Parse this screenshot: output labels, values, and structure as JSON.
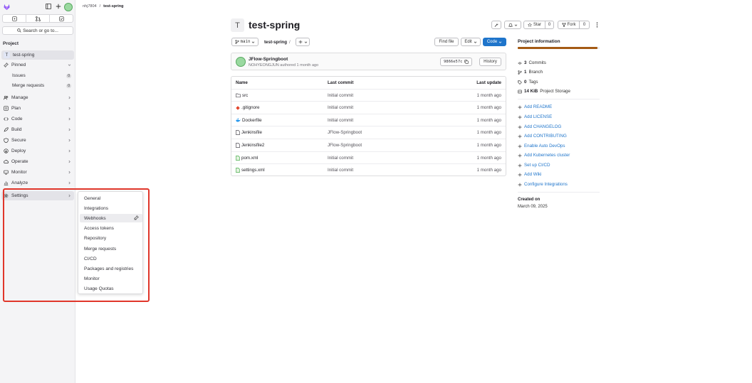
{
  "sidebar": {
    "search_label": "Search or go to...",
    "section_heading": "Project",
    "project_name": "test-spring",
    "project_initial": "T",
    "pinned_label": "Pinned",
    "pinned": [
      {
        "label": "Issues",
        "count": "0"
      },
      {
        "label": "Merge requests",
        "count": "0"
      }
    ],
    "nav": [
      {
        "label": "Manage",
        "icon": "users-icon"
      },
      {
        "label": "Plan",
        "icon": "plan-icon"
      },
      {
        "label": "Code",
        "icon": "code-icon"
      },
      {
        "label": "Build",
        "icon": "rocket-icon"
      },
      {
        "label": "Secure",
        "icon": "shield-icon"
      },
      {
        "label": "Deploy",
        "icon": "deploy-icon"
      },
      {
        "label": "Operate",
        "icon": "cloud-icon"
      },
      {
        "label": "Monitor",
        "icon": "monitor-icon"
      },
      {
        "label": "Analyze",
        "icon": "chart-icon"
      },
      {
        "label": "Settings",
        "icon": "gear-icon"
      }
    ]
  },
  "flyout": {
    "items": [
      "General",
      "Integrations",
      "Webhooks",
      "Access tokens",
      "Repository",
      "Merge requests",
      "CI/CD",
      "Packages and registries",
      "Monitor",
      "Usage Quotas"
    ],
    "hovered": "Webhooks"
  },
  "breadcrumb": {
    "user": "nhj7804",
    "sep": "/",
    "project": "test-spring"
  },
  "project": {
    "initial": "T",
    "title": "test-spring",
    "star_label": "Star",
    "star_count": "0",
    "fork_label": "Fork",
    "fork_count": "0"
  },
  "repo_bar": {
    "branch": "main",
    "path": "test-spring",
    "path_sep": "/",
    "find_file": "Find file",
    "edit": "Edit",
    "code": "Code"
  },
  "commit": {
    "title": "JFlow-Springboot",
    "meta": "NOHYEONGJUN authored 1 month ago",
    "sha": "9866e57c",
    "history": "History"
  },
  "files": {
    "headers": [
      "Name",
      "Last commit",
      "Last update"
    ],
    "rows": [
      {
        "name": "src",
        "type": "folder",
        "commit": "Initial commit",
        "updated": "1 month ago"
      },
      {
        "name": ".gitignore",
        "type": "git",
        "commit": "Initial commit",
        "updated": "1 month ago"
      },
      {
        "name": "Dockerfile",
        "type": "docker",
        "commit": "Initial commit",
        "updated": "1 month ago"
      },
      {
        "name": "Jenkinsfile",
        "type": "file",
        "commit": "JFlow-Springboot",
        "updated": "1 month ago"
      },
      {
        "name": "Jenkinsfile2",
        "type": "file",
        "commit": "JFlow-Springboot",
        "updated": "1 month ago"
      },
      {
        "name": "pom.xml",
        "type": "xml",
        "commit": "Initial commit",
        "updated": "1 month ago"
      },
      {
        "name": "settings.xml",
        "type": "xml",
        "commit": "Initial commit",
        "updated": "1 month ago"
      }
    ]
  },
  "info": {
    "title": "Project information",
    "language_fill": 0.97,
    "commits_n": "3",
    "commits_l": "Commits",
    "branch_n": "1",
    "branch_l": "Branch",
    "tags_n": "0",
    "tags_l": "Tags",
    "storage_n": "14 KiB",
    "storage_l": "Project Storage",
    "links": [
      "Add README",
      "Add LICENSE",
      "Add CHANGELOG",
      "Add CONTRIBUTING",
      "Enable Auto DevOps",
      "Add Kubernetes cluster",
      "Set up CI/CD",
      "Add Wiki",
      "Configure Integrations"
    ],
    "created_label": "Created on",
    "created_value": "March 09, 2025"
  },
  "colors": {
    "accent": "#1f75cb",
    "highlight": "#e0362a",
    "language": "#a45a14"
  }
}
